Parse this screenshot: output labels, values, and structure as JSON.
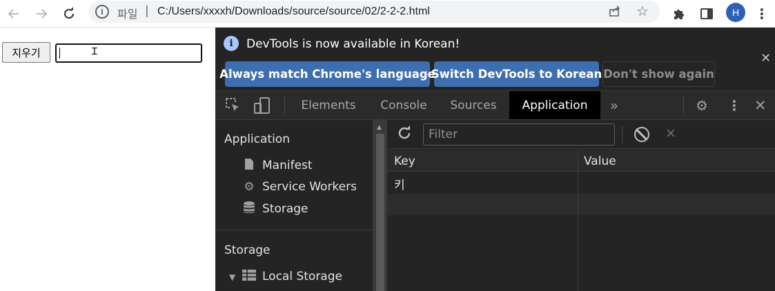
{
  "browser": {
    "back_icon": "arrow-left-icon",
    "forward_icon": "arrow-right-icon",
    "reload_icon": "reload-icon",
    "scheme_label": "파일",
    "separator": "|",
    "url": "C:/Users/xxxxh/Downloads/source/source/02/2-2-2.html",
    "profile_initial": "H",
    "profile_color": "#2b62b8"
  },
  "page": {
    "clear_button_label": "지우기",
    "input_value": ""
  },
  "devtools": {
    "infobar": {
      "message": "DevTools is now available in Korean!",
      "buttons": [
        "Always match Chrome's language",
        "Switch DevTools to Korean",
        "Don't show again"
      ]
    },
    "tabs": [
      "Elements",
      "Console",
      "Sources",
      "Application"
    ],
    "active_tab": "Application",
    "more_tabs": "»",
    "sidebar": {
      "application_heading": "Application",
      "application_items": [
        "Manifest",
        "Service Workers",
        "Storage"
      ],
      "storage_heading": "Storage",
      "storage_items": [
        "Local Storage"
      ]
    },
    "storage_view": {
      "filter_placeholder": "Filter",
      "columns": [
        "Key",
        "Value"
      ],
      "rows": [
        {
          "key": "키",
          "value": ""
        }
      ]
    },
    "accent_color": "#3d6fb0"
  }
}
